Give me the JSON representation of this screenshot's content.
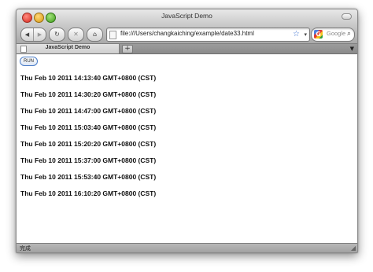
{
  "window": {
    "title": "JavaScript Demo"
  },
  "toolbar": {
    "back_icon": "back-arrow-icon",
    "forward_icon": "forward-arrow-icon",
    "reload_icon": "reload-icon",
    "stop_icon": "stop-icon",
    "home_icon": "home-icon",
    "address": "file:///Users/changkaiching/example/date33.html",
    "search_placeholder": "Google"
  },
  "tabs": [
    {
      "label": "JavaScript Demo"
    }
  ],
  "content": {
    "run_label": "RUN",
    "dates": [
      "Thu Feb 10 2011 14:13:40 GMT+0800 (CST)",
      "Thu Feb 10 2011 14:30:20 GMT+0800 (CST)",
      "Thu Feb 10 2011 14:47:00 GMT+0800 (CST)",
      "Thu Feb 10 2011 15:03:40 GMT+0800 (CST)",
      "Thu Feb 10 2011 15:20:20 GMT+0800 (CST)",
      "Thu Feb 10 2011 15:37:00 GMT+0800 (CST)",
      "Thu Feb 10 2011 15:53:40 GMT+0800 (CST)",
      "Thu Feb 10 2011 16:10:20 GMT+0800 (CST)"
    ]
  },
  "status": {
    "text": "完成"
  }
}
